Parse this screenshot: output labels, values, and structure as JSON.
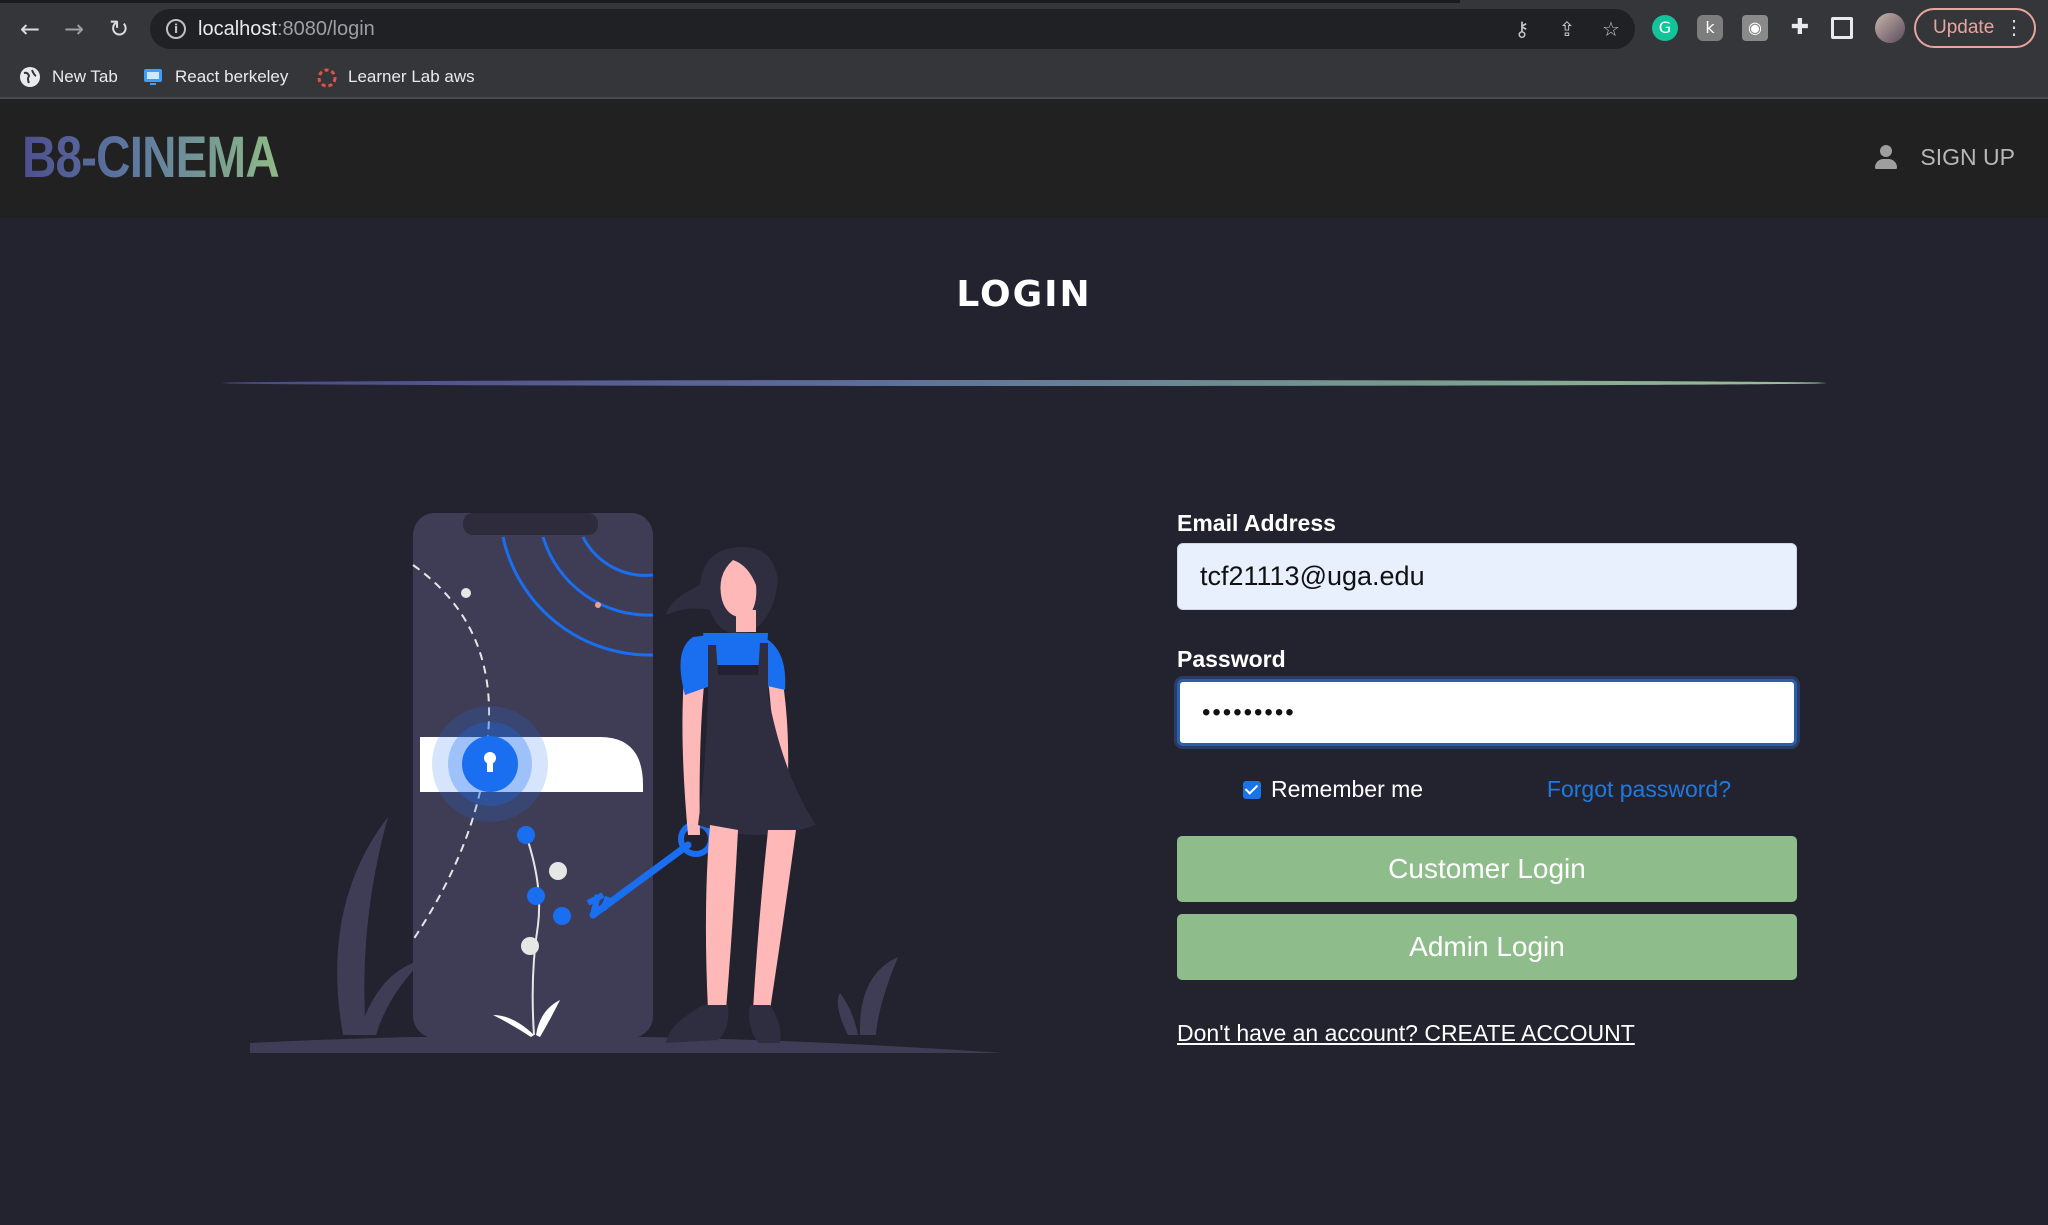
{
  "browser": {
    "url_host": "localhost",
    "url_path": ":8080/login",
    "update_label": "Update",
    "bookmarks": [
      {
        "label": "New Tab",
        "icon": "globe-icon"
      },
      {
        "label": "React berkeley",
        "icon": "monitor-icon"
      },
      {
        "label": "Learner Lab aws",
        "icon": "aws-icon"
      }
    ]
  },
  "header": {
    "logo": "B8-CINEMA",
    "signup_label": "SIGN UP"
  },
  "main": {
    "title": "LOGIN",
    "email_label": "Email Address",
    "email_value": "tcf21113@uga.edu",
    "password_label": "Password",
    "password_value": "•••••••••",
    "remember_label": "Remember me",
    "remember_checked": true,
    "forgot_label": "Forgot password?",
    "customer_login_label": "Customer Login",
    "admin_login_label": "Admin Login",
    "create_account_label": "Don't have an account? CREATE ACCOUNT"
  },
  "colors": {
    "page_bg": "#23222f",
    "header_bg": "#212121",
    "button_green": "#8fbc8b",
    "link_blue": "#1f7ae0",
    "accent_blue": "#1a6ef0"
  }
}
